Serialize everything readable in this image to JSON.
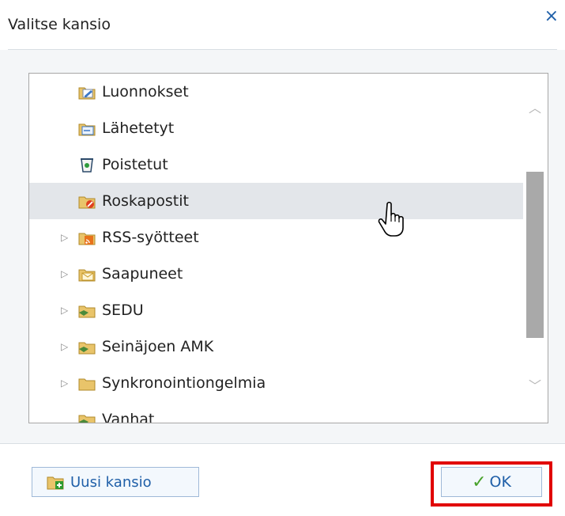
{
  "dialog": {
    "title": "Valitse kansio",
    "close_glyph": "×"
  },
  "folders": [
    {
      "label": "Luonnokset",
      "icon": "drafts-folder-icon",
      "expandable": false,
      "selected": false
    },
    {
      "label": "Lähetetyt",
      "icon": "sent-folder-icon",
      "expandable": false,
      "selected": false
    },
    {
      "label": "Poistetut",
      "icon": "deleted-folder-icon",
      "expandable": false,
      "selected": false
    },
    {
      "label": "Roskapostit",
      "icon": "junk-folder-icon",
      "expandable": false,
      "selected": true
    },
    {
      "label": "RSS-syötteet",
      "icon": "rss-folder-icon",
      "expandable": true,
      "selected": false
    },
    {
      "label": "Saapuneet",
      "icon": "inbox-folder-icon",
      "expandable": true,
      "selected": false
    },
    {
      "label": "SEDU",
      "icon": "shared-folder-icon",
      "expandable": true,
      "selected": false
    },
    {
      "label": "Seinäjoen AMK",
      "icon": "shared-folder-icon",
      "expandable": true,
      "selected": false
    },
    {
      "label": "Synkronointiongelmia",
      "icon": "folder-icon",
      "expandable": true,
      "selected": false
    },
    {
      "label": "Vanhat",
      "icon": "shared-folder-icon",
      "expandable": false,
      "selected": false
    }
  ],
  "buttons": {
    "new_folder_label": "Uusi kansio",
    "ok_label": "OK"
  },
  "colors": {
    "accent": "#1f5fa8",
    "highlight": "#e10000",
    "selection": "#e3e6ea",
    "check": "#47a12a"
  }
}
